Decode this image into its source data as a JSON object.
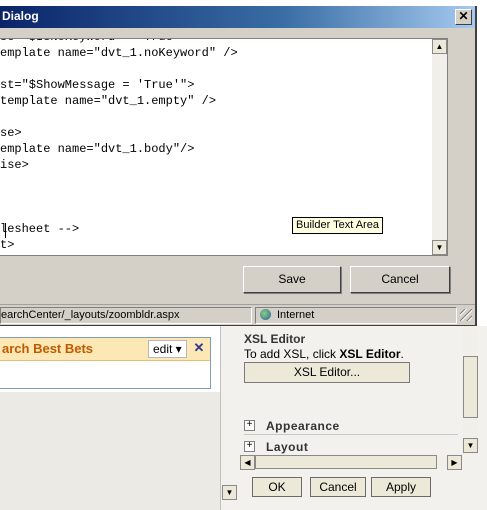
{
  "dialog": {
    "title": "Dialog",
    "code_lines": [
      "se \"$IsNoKeyword = 'True'\">",
      "emplate name=\"dvt_1.noKeyword\" />",
      "",
      "st=\"$ShowMessage = 'True'\">",
      "template name=\"dvt_1.empty\" />",
      "",
      "se>",
      "emplate name=\"dvt_1.body\"/>",
      "ise>",
      "",
      "",
      "",
      "lesheet -->",
      "t>"
    ],
    "tooltip": "Builder Text Area",
    "save_label": "Save",
    "cancel_label": "Cancel",
    "status_url": "earchCenter/_layouts/zoombldr.aspx",
    "status_zone": "Internet"
  },
  "webpart": {
    "title": "arch Best Bets",
    "edit_label": "edit ▾",
    "close_glyph": "✕"
  },
  "toolpane": {
    "xsl_heading": "XSL Editor",
    "xsl_desc_prefix": "To add XSL, click ",
    "xsl_desc_bold": "XSL Editor",
    "xsl_desc_suffix": ".",
    "xsl_button": "XSL Editor...",
    "sections": [
      "Appearance",
      "Layout"
    ]
  },
  "footer": {
    "ok_label": "OK",
    "cancel_label": "Cancel",
    "apply_label": "Apply"
  }
}
